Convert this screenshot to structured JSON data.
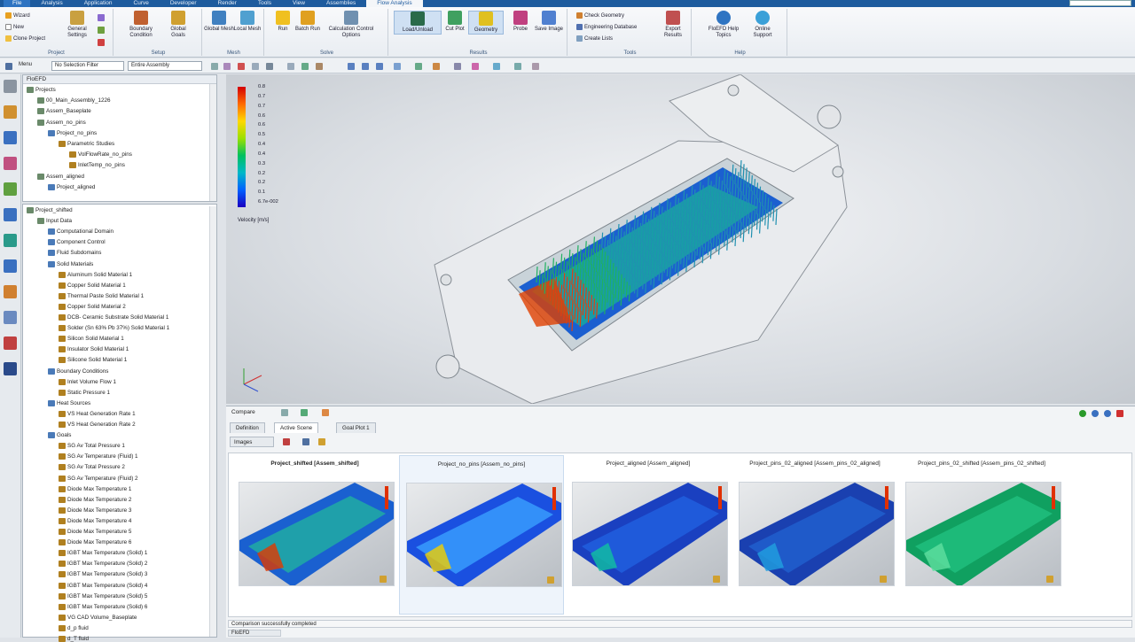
{
  "ribbon_tabs": [
    "File",
    "Analysis",
    "Application",
    "Curve",
    "Developer",
    "Render",
    "Tools",
    "View",
    "Assemblies",
    "Flow Analysis"
  ],
  "ribbon": {
    "project": {
      "label": "Project",
      "wizard": "Wizard",
      "new": "New",
      "clone": "Clone Project",
      "general": "General Settings"
    },
    "setup": {
      "label": "Setup",
      "boundary": "Boundary Condition",
      "goals": "Global Goals"
    },
    "mesh": {
      "label": "Mesh",
      "global": "Global Mesh",
      "local": "Local Mesh"
    },
    "solve": {
      "label": "Solve",
      "run": "Run",
      "batch": "Batch Run",
      "calc": "Calculation Control Options"
    },
    "results": {
      "label": "Results",
      "load": "Load/Unload",
      "cut": "Cut Plot",
      "geometry": "Geometry",
      "probe": "Probe",
      "save": "Save Image"
    },
    "tools": {
      "label": "Tools",
      "check": "Check Geometry",
      "engdb": "Engineering Database",
      "lists": "Create Lists",
      "export": "Export Results"
    },
    "help": {
      "label": "Help",
      "topics": "FloEFD Help Topics",
      "support": "Online Support"
    }
  },
  "toolbar2": {
    "menu": "Menu",
    "filter": "No Selection Filter",
    "assembly": "Entire Assembly"
  },
  "panel_title": "FloEFD",
  "tree_top": [
    {
      "t": "Projects",
      "d": 0
    },
    {
      "t": "00_Main_Assembly_1226",
      "d": 1
    },
    {
      "t": "Assem_Baseplate",
      "d": 1
    },
    {
      "t": "Assem_no_pins",
      "d": 1
    },
    {
      "t": "Project_no_pins",
      "d": 2
    },
    {
      "t": "Parametric Studies",
      "d": 3
    },
    {
      "t": "VolFlowRate_no_pins",
      "d": 4
    },
    {
      "t": "InletTemp_no_pins",
      "d": 4
    },
    {
      "t": "Assem_aligned",
      "d": 1
    },
    {
      "t": "Project_aligned",
      "d": 2
    }
  ],
  "tree_main": [
    {
      "t": "Project_shifted",
      "d": 0
    },
    {
      "t": "Input Data",
      "d": 1
    },
    {
      "t": "Computational Domain",
      "d": 2
    },
    {
      "t": "Component Control",
      "d": 2
    },
    {
      "t": "Fluid Subdomains",
      "d": 2
    },
    {
      "t": "Solid Materials",
      "d": 2
    },
    {
      "t": "Aluminum Solid Material 1",
      "d": 3
    },
    {
      "t": "Copper Solid Material 1",
      "d": 3
    },
    {
      "t": "Thermal Paste Solid Material 1",
      "d": 3
    },
    {
      "t": "Copper Solid Material 2",
      "d": 3
    },
    {
      "t": "DCB- Ceramic Substrate Solid Material 1",
      "d": 3
    },
    {
      "t": "Solder (Sn 63% Pb 37%) Solid Material 1",
      "d": 3
    },
    {
      "t": "Silicon Solid Material 1",
      "d": 3
    },
    {
      "t": "Insulator Solid Material 1",
      "d": 3
    },
    {
      "t": "Silicone Solid Material 1",
      "d": 3
    },
    {
      "t": "Boundary Conditions",
      "d": 2
    },
    {
      "t": "Inlet Volume Flow 1",
      "d": 3
    },
    {
      "t": "Static Pressure 1",
      "d": 3
    },
    {
      "t": "Heat Sources",
      "d": 2
    },
    {
      "t": "VS Heat Generation Rate 1",
      "d": 3
    },
    {
      "t": "VS Heat Generation Rate 2",
      "d": 3
    },
    {
      "t": "Goals",
      "d": 2
    },
    {
      "t": "SG Av Total Pressure 1",
      "d": 3
    },
    {
      "t": "SG Av Temperature (Fluid) 1",
      "d": 3
    },
    {
      "t": "SG Av Total Pressure 2",
      "d": 3
    },
    {
      "t": "SG Av Temperature (Fluid) 2",
      "d": 3
    },
    {
      "t": "Diode Max Temperature 1",
      "d": 3
    },
    {
      "t": "Diode Max Temperature 2",
      "d": 3
    },
    {
      "t": "Diode Max Temperature 3",
      "d": 3
    },
    {
      "t": "Diode Max Temperature 4",
      "d": 3
    },
    {
      "t": "Diode Max Temperature 5",
      "d": 3
    },
    {
      "t": "Diode Max Temperature 6",
      "d": 3
    },
    {
      "t": "IGBT Max Temperature (Solid) 1",
      "d": 3
    },
    {
      "t": "IGBT Max Temperature (Solid) 2",
      "d": 3
    },
    {
      "t": "IGBT Max Temperature (Solid) 3",
      "d": 3
    },
    {
      "t": "IGBT Max Temperature (Solid) 4",
      "d": 3
    },
    {
      "t": "IGBT Max Temperature (Solid) 5",
      "d": 3
    },
    {
      "t": "IGBT Max Temperature (Solid) 6",
      "d": 3
    },
    {
      "t": "VG CAD Volume_Baseplate",
      "d": 3
    },
    {
      "t": "d_p fluid",
      "d": 3
    },
    {
      "t": "d_T fluid",
      "d": 3
    }
  ],
  "legend": {
    "values": [
      "0.8",
      "0.7",
      "0.7",
      "0.6",
      "0.6",
      "0.5",
      "0.4",
      "0.4",
      "0.3",
      "0.2",
      "0.2",
      "0.1",
      "6.7e-002"
    ],
    "label": "Velocity [m/s]"
  },
  "compare": {
    "tabs": [
      "Compare",
      "Definition",
      "Active Scene",
      "Goal Plot 1"
    ],
    "images_btn": "Images",
    "columns": [
      "Project_shifted [Assem_shifted]",
      "Project_no_pins [Assem_no_pins]",
      "Project_aligned [Assem_aligned]",
      "Project_pins_02_aligned [Assem_pins_02_aligned]",
      "Project_pins_02_shifted [Assem_pins_02_shifted]"
    ],
    "status": "Comparison successfully completed",
    "taskbar": "FloEFD"
  },
  "colors": {
    "accent": "#1e5b9e",
    "selected": "#cfe0f3"
  }
}
